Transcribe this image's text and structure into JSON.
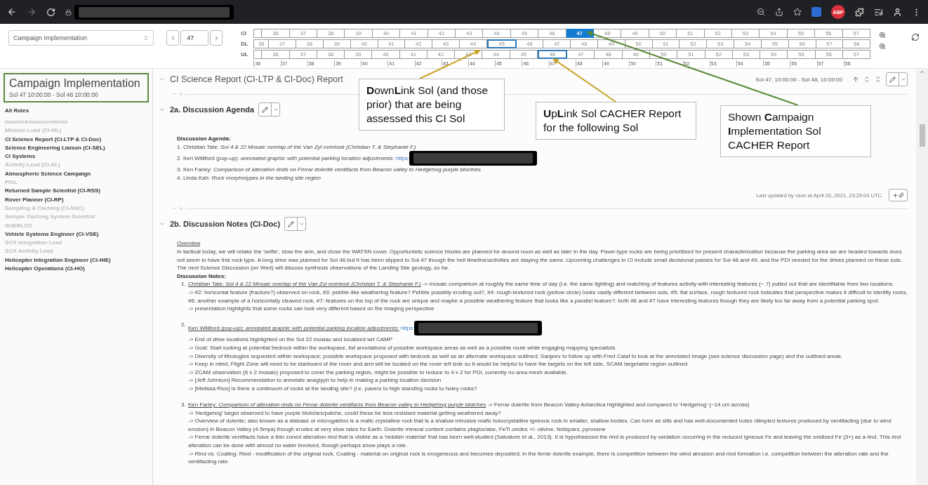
{
  "browser": {
    "extension_badge": "ABP"
  },
  "toolbar": {
    "campaign_select": "Campaign Implementation",
    "sol_value": "47"
  },
  "sol_timeline": {
    "tracks": [
      {
        "label": "CI",
        "kind": "campaign",
        "sols": [
          {
            "label": "36",
            "selected": false
          },
          {
            "label": "37",
            "selected": false
          },
          {
            "label": "38",
            "selected": false
          },
          {
            "label": "39",
            "selected": false
          },
          {
            "label": "40",
            "selected": false
          },
          {
            "label": "41",
            "selected": false
          },
          {
            "label": "42",
            "selected": false
          },
          {
            "label": "43",
            "selected": false
          },
          {
            "label": "44",
            "selected": false
          },
          {
            "label": "45",
            "selected": false
          },
          {
            "label": "46",
            "selected": false
          },
          {
            "label": "47",
            "selected": true
          },
          {
            "label": "48",
            "selected": false
          },
          {
            "label": "49",
            "selected": false
          },
          {
            "label": "50",
            "selected": false
          },
          {
            "label": "51",
            "selected": false
          },
          {
            "label": "52",
            "selected": false
          },
          {
            "label": "53",
            "selected": false
          },
          {
            "label": "54",
            "selected": false
          },
          {
            "label": "55",
            "selected": false
          },
          {
            "label": "56",
            "selected": false
          },
          {
            "label": "57",
            "selected": false
          }
        ]
      },
      {
        "label": "DL",
        "kind": "downlink",
        "sols": [
          {
            "label": "36",
            "selected": false
          },
          {
            "label": "37",
            "selected": false
          },
          {
            "label": "38",
            "selected": false
          },
          {
            "label": "39",
            "selected": false
          },
          {
            "label": "40",
            "selected": false
          },
          {
            "label": "41",
            "selected": false
          },
          {
            "label": "42",
            "selected": false
          },
          {
            "label": "43",
            "selected": false
          },
          {
            "label": "44",
            "selected": false
          },
          {
            "label": "45",
            "selected": true
          },
          {
            "label": "46",
            "selected": false
          },
          {
            "label": "47",
            "selected": false
          },
          {
            "label": "48",
            "selected": false
          },
          {
            "label": "49",
            "selected": false
          },
          {
            "label": "50",
            "selected": false
          },
          {
            "label": "51",
            "selected": false
          },
          {
            "label": "52",
            "selected": false
          },
          {
            "label": "53",
            "selected": false
          },
          {
            "label": "54",
            "selected": false
          },
          {
            "label": "55",
            "selected": false
          },
          {
            "label": "56",
            "selected": false
          },
          {
            "label": "57",
            "selected": false
          },
          {
            "label": "58",
            "selected": false
          }
        ]
      },
      {
        "label": "UL",
        "kind": "uplink",
        "sols": [
          {
            "label": "36",
            "selected": false
          },
          {
            "label": "37",
            "selected": false
          },
          {
            "label": "38",
            "selected": false
          },
          {
            "label": "39",
            "selected": false
          },
          {
            "label": "40",
            "selected": false
          },
          {
            "label": "41",
            "selected": false
          },
          {
            "label": "42",
            "selected": false
          },
          {
            "label": "43",
            "selected": false
          },
          {
            "label": "44",
            "selected": false
          },
          {
            "label": "45",
            "selected": false
          },
          {
            "label": "46",
            "selected": true
          },
          {
            "label": "47",
            "selected": false
          },
          {
            "label": "48",
            "selected": false
          },
          {
            "label": "49",
            "selected": false
          },
          {
            "label": "50",
            "selected": false
          },
          {
            "label": "51",
            "selected": false
          },
          {
            "label": "52",
            "selected": false
          },
          {
            "label": "53",
            "selected": false
          },
          {
            "label": "54",
            "selected": false
          },
          {
            "label": "55",
            "selected": false
          },
          {
            "label": "56",
            "selected": false
          },
          {
            "label": "57",
            "selected": false
          }
        ]
      }
    ],
    "axis": [
      "36",
      "37",
      "38",
      "39",
      "40",
      "41",
      "42",
      "43",
      "44",
      "45",
      "46",
      "47",
      "48",
      "49",
      "50",
      "51",
      "52",
      "53",
      "54",
      "55",
      "56",
      "57",
      "58"
    ]
  },
  "sidebar": {
    "title": "Campaign Implementation",
    "subtitle": "Sol 47 10:00:00 - Sol 48 10:00:00",
    "all_roles": "All Roles",
    "roles": [
      {
        "label": "Issues/Announcements",
        "disabled": true
      },
      {
        "label": "Mission Lead (CI-ML)",
        "disabled": true
      },
      {
        "label": "CI Science Report (CI-LTP & CI-Doc)",
        "disabled": false
      },
      {
        "label": "Science Engineering Liaison (CI-SEL)",
        "disabled": false
      },
      {
        "label": "CI Systems",
        "disabled": false
      },
      {
        "label": "Activity Lead (CI-AL)",
        "disabled": true
      },
      {
        "label": "Atmospheric Science Campaign",
        "disabled": false
      },
      {
        "label": "PIXL",
        "disabled": true
      },
      {
        "label": "Returned Sample Scientist (CI-RSS)",
        "disabled": false
      },
      {
        "label": "Rover Planner (CI-RP)",
        "disabled": false
      },
      {
        "label": "Sampling & Caching (CI-SNC)",
        "disabled": true
      },
      {
        "label": "Sample Caching System Scientist",
        "disabled": true
      },
      {
        "label": "SHERLOC",
        "disabled": true
      },
      {
        "label": "Vehicle Systems Engineer (CI-VSE)",
        "disabled": false
      },
      {
        "label": "SOX Integration Lead",
        "disabled": true
      },
      {
        "label": "SOX Activity Lead",
        "disabled": true
      },
      {
        "label": "Helicopter Integration Engineer (CI-HIE)",
        "disabled": false
      },
      {
        "label": "Helicopter Operations (CI-HO)",
        "disabled": false
      }
    ]
  },
  "report": {
    "title": "CI Science Report (CI-LTP & CI-Doc) Report",
    "range": "Sol 47, 10:00:00 - Sol 48, 10:00:00",
    "sections": [
      {
        "kind": "agenda",
        "heading": "2a. Discussion Agenda",
        "expanded": true,
        "label": "Discussion Agenda:",
        "items": [
          {
            "text": "1. Christian Tate: *Sol 4 & 22 Mosaic overlap of the Van Zyl overlook (Christian T. & Stephanie F.)*"
          },
          {
            "text": "2. Ken Williford (pop-up): *annotated graphic with potential parking location adjustments:*",
            "url": "https:"
          },
          {
            "text": "3. Ken Farley: *Comparison of alteration rinds on Ferrar dolerite ventifacts from Beacon valley to Hedgehog purple blocthes*"
          },
          {
            "text": "4. Linda Kah: *Rock morphotypes in the landing site region*"
          }
        ],
        "updated": "Last updated by vsun at April 20, 2021, 23:29:04 UTC."
      },
      {
        "kind": "notes",
        "heading": "2b. Discussion Notes (CI-Doc)",
        "expanded": true,
        "overview_label": "Overview",
        "overview": "In tactical today, we will retake the 'selfie', stow the arm, and close the WATSN cover. Opportunistic science blocks are planned for around noon as well as later in the day. Paver-type rocks are being prioritized for present characterization because the parking area we are headed towards does not seem to have this rock type. A long drive was planned for Sol 46 but it has been slipped to Sol 47 though the heli timeline/activities are staying the same. Upcoming challenges in CI include small decisional passes for Sol 48 and 49, and the PDI needed for the drives planned on these sols. The next Science Discussion (on Wed) will discuss synthesis observations of the Landing Site geology, so far.",
        "notes_label": "Discussion Notes:",
        "notes": [
          {
            "number": "1.",
            "link": "Christian Tate: *Sol 4 & 22 Mosaic overlap of the Van Zyl overlook (Christian T. & Stephanie F.)*",
            "rest": " -> mosaic comparison at roughly the same time of day (i.e. the same lighting) and matching of features activity with interesting features (~ 7) pulled out that are identifiable from two locations.",
            "points": [
              "-> #2: horizontal feature (fracture?) observed on rock, #3: pebble-like weathering feature? Pebble possibly eroding out?, #4: rough-textured rock (yellow circle) looks vastly different between sols, #5: flat surface, rough textured rock indicates that perspective makes it difficult to identify rocks, #6: another example of a horizontally cleaved rock, #7: features on the top of the rock are unique and maybe a possible weathering feature that looks like a parallel feature?; both #6 and #7 have interesting features though they are likely too far away from a potential parking spot.",
              "-> presentation highlights that some rocks can look very different based on the imaging perspective"
            ]
          },
          {
            "number": "2.",
            "link": "Ken Williford (pop-up): *annotated graphic with potential parking location adjustments:*",
            "url": "https:",
            "points": [
              "-> End of drive locations highlighted on the Sol 22 mosiac and localized wrt CAMP",
              "-> Goal: Start looking at potential bedrock within the workspace, list annotations of possible workspace areas as well as a possible route while engaging mapping specialists",
              "-> Diversity of lithologies requested within workspace; possible workspace proposed with bedrock as well as an alternate workspace outlined; Sanjeev to follow up with Fred Calaf to look at the annotated image (see science discussion page) and the outlined areas.",
              "-> Keep in mind, Flight Zone will need to be starboard of the rover and arm will be located on the rover left side so it would be helpful to have the targets on the left side, SCAM targetable region outlined",
              "-> ZCAM observation (6 x 2 mosaic) proposed to cover the parking region, might be possible to reduce to 4 x 2 for PDI, currently no area mesh available.",
              "-> [Jeff Johnson] Recommendation to annotate anaglyph to help in making a parking location decision",
              "-> [Melissa Rice] Is there a continuum of rocks at the landing site? (i.e. pavers to high standing rocks to holey rocks?"
            ]
          },
          {
            "number": "3.",
            "link": "Ken Farley: *Comparison of alteration rinds on Ferrar dolerite ventifacts from Beacon valley to Hedgehog purple blotches*",
            "rest": " -> Ferrar dolerite from Beacon Valley Antarctica highlighted and compared to 'Hedgehog' (~14 cm across)",
            "points": [
              "-> 'Hedgehog' target observed to have purple blotches/patche, could these be less resistant material getting weathered away?",
              "-> Overview of dolerite; also known as a diabase or microgabbro is a mafic crystalline rock that is a shallow intrusive mafic holocrystalline igneous rock in smaller, shallow bodies. Can form as sills and has well-documented holes /dimpled textures produced by ventifacting (due to wind erosion) in Beacon Valley (4-5mya) though erodes at very slow rates for Earth. Dolerite mineral content contains plagioclase, FeTi oxides +/- olivine, feldspars, pyroxene",
              "-> Ferrar dolerite ventifacts have a thin zoned alteration rind that is visible as a 'reddish material' that has been well-studied (Salvatore et al., 2013). It is hypothesized the rind is produced by oxidation occurring in the reduced igneous Fe and leaving the oxidized Fe (3+) as a rind. This rind alteration can be done with almost no water involved, though perhaps snow plays a role.",
              "-> Rind vs. Coating: Rind - modification of the original rock, Coating - material on original rock is exogeneous and becomes deposited; in the ferrar dolerite example, there is competition between the wind abrasion and rind formation i.e. competition between the alteration rate and the ventifacting rate."
            ]
          }
        ]
      }
    ]
  },
  "annotations": [
    {
      "text": "**D**own**L**ink Sol (and those prior) that are being assessed this CI Sol",
      "color": "#c9a227"
    },
    {
      "text": "**U**p**L**ink Sol CACHER Report for the following Sol",
      "color": "#c9a227"
    },
    {
      "text": "Shown **C**ampaign **I**mplementation Sol CACHER Report",
      "color": "#5b8a3c"
    }
  ]
}
